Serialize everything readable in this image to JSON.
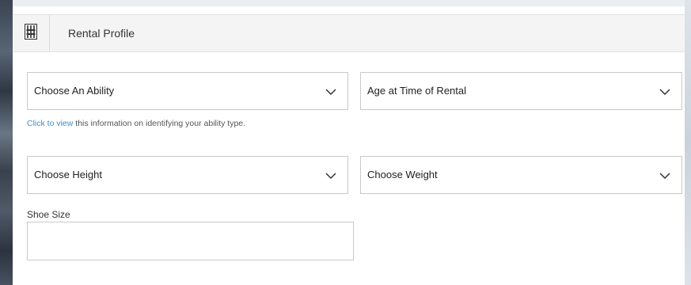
{
  "panel": {
    "title": "Rental Profile",
    "header_icon": "ski-rack-icon"
  },
  "fields": {
    "ability": {
      "label": "Choose An Ability",
      "icon": "chevron-down-icon"
    },
    "age": {
      "label": "Age at Time of Rental",
      "icon": "chevron-down-icon"
    },
    "height": {
      "label": "Choose Height",
      "icon": "chevron-down-icon"
    },
    "weight": {
      "label": "Choose Weight",
      "icon": "chevron-down-icon"
    }
  },
  "helper": {
    "link_text": "Click to view",
    "text": " this information on identifying your ability type."
  },
  "shoe_size": {
    "label": "Shoe Size",
    "value": "",
    "placeholder": ""
  },
  "colors": {
    "link": "#3a8fd1",
    "border": "#c9c9c9",
    "header_bg": "#f4f4f4"
  }
}
